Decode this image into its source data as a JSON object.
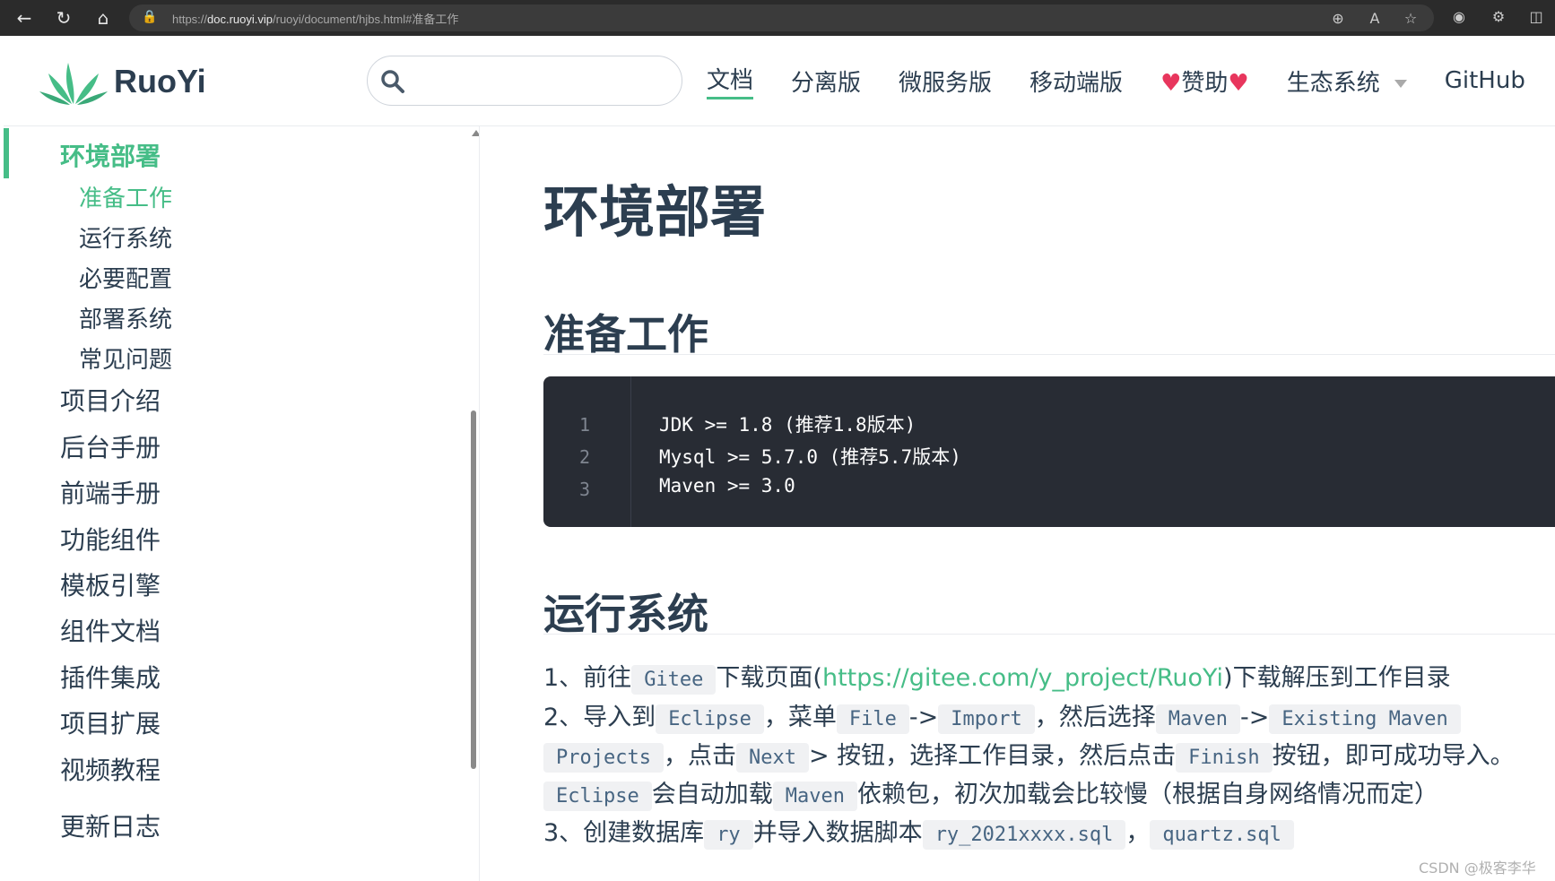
{
  "browser": {
    "url_prefix": "https://",
    "url_host": "doc.ruoyi.vip",
    "url_path": "/ruoyi/document/hjbs.html#准备工作"
  },
  "header": {
    "logo_text": "RuoYi",
    "search_placeholder": "",
    "nav": [
      {
        "label": "文档",
        "active": true
      },
      {
        "label": "分离版"
      },
      {
        "label": "微服务版"
      },
      {
        "label": "移动端版"
      },
      {
        "label": "赞助"
      },
      {
        "label": "生态系统"
      },
      {
        "label": "GitHub"
      }
    ]
  },
  "sidebar": {
    "group": "环境部署",
    "subitems": [
      "准备工作",
      "运行系统",
      "必要配置",
      "部署系统",
      "常见问题"
    ],
    "items": [
      "项目介绍",
      "后台手册",
      "前端手册",
      "功能组件",
      "模板引擎",
      "组件文档",
      "插件集成",
      "项目扩展",
      "视频教程",
      "更新日志"
    ]
  },
  "content": {
    "title": "环境部署",
    "section1": "准备工作",
    "code_lines": [
      {
        "n": "1",
        "text": "JDK >= 1.8 (推荐1.8版本)"
      },
      {
        "n": "2",
        "text": "Mysql >= 5.7.0 (推荐5.7版本)"
      },
      {
        "n": "3",
        "text": "Maven >= 3.0"
      }
    ],
    "section2": "运行系统",
    "p1": {
      "a": "1、前往",
      "code1": "Gitee",
      "b": "下载页面(",
      "link": "https://gitee.com/y_project/RuoYi",
      "c": ")下载解压到工作目录"
    },
    "p2": {
      "a": "2、导入到",
      "code1": "Eclipse",
      "b": "，菜单",
      "code2": "File",
      "c": "->",
      "code3": "Import",
      "d": "，然后选择",
      "code4": "Maven",
      "e": "->",
      "code5": "Existing Maven",
      "code6": "Projects",
      "f": "，点击",
      "code7": "Next",
      "g": "> 按钮，选择工作目录，然后点击",
      "code8": "Finish",
      "h": "按钮，即可成功导入。",
      "code9": "Eclipse",
      "i": "会自动加载",
      "code10": "Maven",
      "j": "依赖包，初次加载会比较慢（根据自身网络情况而定）"
    },
    "p3": {
      "a": "3、创建数据库",
      "code1": "ry",
      "b": "并导入数据脚本",
      "code2": "ry_2021xxxx.sql",
      "c": "，",
      "code3": "quartz.sql"
    }
  },
  "watermark": "CSDN @极客李华",
  "colors": {
    "accent": "#46bd87",
    "text": "#2c3e50",
    "code_bg": "#282c34"
  }
}
